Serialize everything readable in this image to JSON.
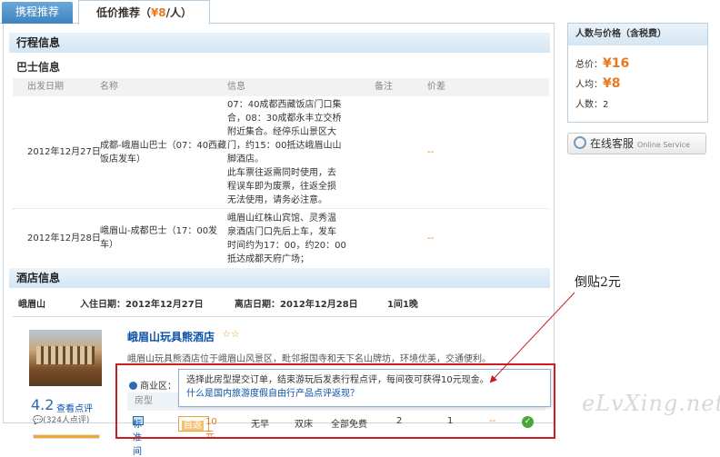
{
  "tabs": [
    {
      "label": "携程推荐"
    },
    {
      "label_prefix": "低价推荐（",
      "price": "¥8",
      "label_suffix": "/人）"
    }
  ],
  "itinerary": {
    "section_title": "行程信息",
    "bus_title": "巴士信息",
    "columns": [
      "出发日期",
      "名称",
      "信息",
      "备注",
      "价差"
    ],
    "rows": [
      {
        "date": "2012年12月27日",
        "name": [
          "成都-峨眉山巴士（07：40西藏",
          "饭店发车）"
        ],
        "info": [
          "07：40成都西藏饭店门口集",
          "合，08：30成都永丰立交桥",
          "附近集合。经停乐山景区大",
          "门，约15：00抵达峨眉山山",
          "脚酒店。",
          "此车票往返需同时使用，去",
          "程误车即为废票，往返全损",
          "无法使用，请务必注意。"
        ],
        "note": "",
        "diff": "--"
      },
      {
        "date": "2012年12月28日",
        "name": [
          "峨眉山-成都巴士（17：00发",
          "车）"
        ],
        "info": [
          "峨眉山红株山宾馆、灵秀温",
          "泉酒店门口先后上车，发车",
          "时间约为17：00，约20：00",
          "抵达成都天府广场；"
        ],
        "note": "",
        "diff": "--"
      }
    ]
  },
  "hotel": {
    "section_title": "酒店信息",
    "city": "峨眉山",
    "checkin": "入住日期：2012年12月27日",
    "checkout": "离店日期：2012年12月28日",
    "rooms_nights": "1间1晚",
    "name": "峨眉山玩具熊酒店",
    "stars": "☆☆",
    "description": "峨眉山玩具熊酒店位于峨眉山风景区，毗邻报国寺和天下名山牌坊，环境优美，交通便利。",
    "score": "4.2",
    "review_link": "查看点评",
    "review_count": "(324人点评)",
    "commerce_label": "商业区：",
    "room_header": "房型",
    "room": {
      "name": "标准间",
      "fan_label": "自返",
      "fan_amount": "10元",
      "breakfast": "无早",
      "bed": "双床",
      "network": "全部免费",
      "people": "2",
      "qty": "1",
      "diff": "--"
    },
    "tooltip": {
      "line1": "选择此房型提交订单，结束游玩后发表行程点评，每间夜可获得10元现金。",
      "line2": "什么是国内旅游度假自由行产品点评返现？"
    }
  },
  "annotation": "倒贴2元",
  "watermark": "eLvXing.net",
  "sidebar": {
    "title": "人数与价格（含税费）",
    "total_label": "总价：",
    "total": "¥16",
    "avg_label": "人均：",
    "avg": "¥8",
    "people_label": "人数：",
    "people": "2",
    "service_label": "在线客服",
    "service_en": "Online Service"
  }
}
